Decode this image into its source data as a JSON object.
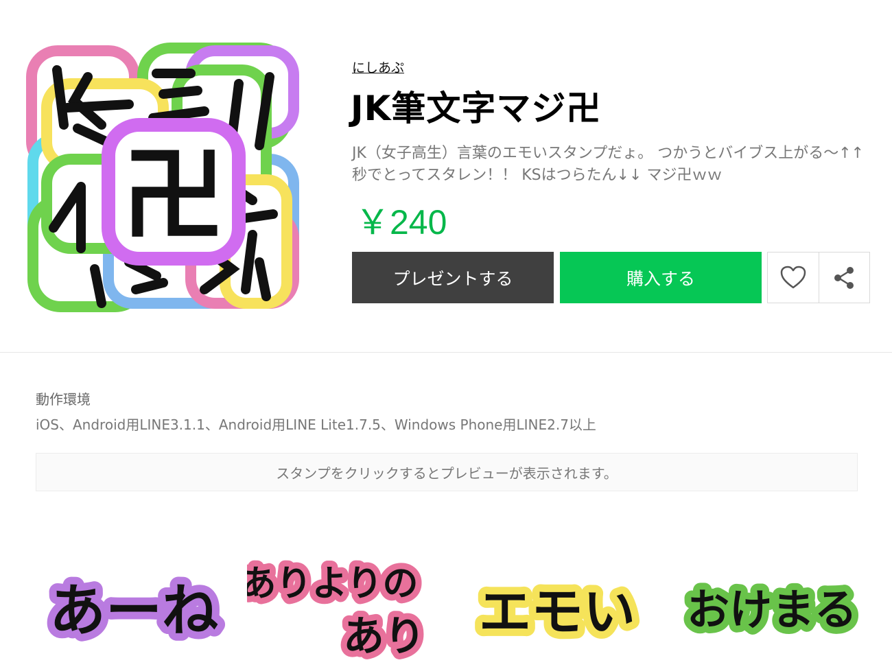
{
  "product": {
    "author": "にしあぷ",
    "title": "JK筆文字マジ卍",
    "description": "JK（女子高生）言葉のエモいスタンプだょ。 つかうとバイブス上がる〜↑↑ 秒でとってスタレン！！ KSはつらたん↓↓ マジ卍ｗｗ",
    "price": "￥240",
    "cover_text": "卍",
    "cover_outline_colors": [
      "#e97fb3",
      "#6fd24d",
      "#f7e25c",
      "#c77cf0",
      "#7fb6ee",
      "#5fd9ec"
    ],
    "accent_color": "#06c755"
  },
  "actions": {
    "gift_label": "プレゼントする",
    "buy_label": "購入する",
    "favorite_icon": "heart-icon",
    "share_icon": "share-icon"
  },
  "environment": {
    "label": "動作環境",
    "value": "iOS、Android用LINE3.1.1、Android用LINE Lite1.7.5、Windows Phone用LINE2.7以上"
  },
  "notice": "スタンプをクリックするとプレビューが表示されます。",
  "stickers": [
    {
      "lines": [
        "あーね"
      ],
      "outline": "#b97be0"
    },
    {
      "lines": [
        "ありよりの",
        "あり"
      ],
      "outline": "#e8719b"
    },
    {
      "lines": [
        "エモい"
      ],
      "outline": "#f5e35a"
    },
    {
      "lines": [
        "おけまる"
      ],
      "outline": "#69c34a"
    }
  ]
}
